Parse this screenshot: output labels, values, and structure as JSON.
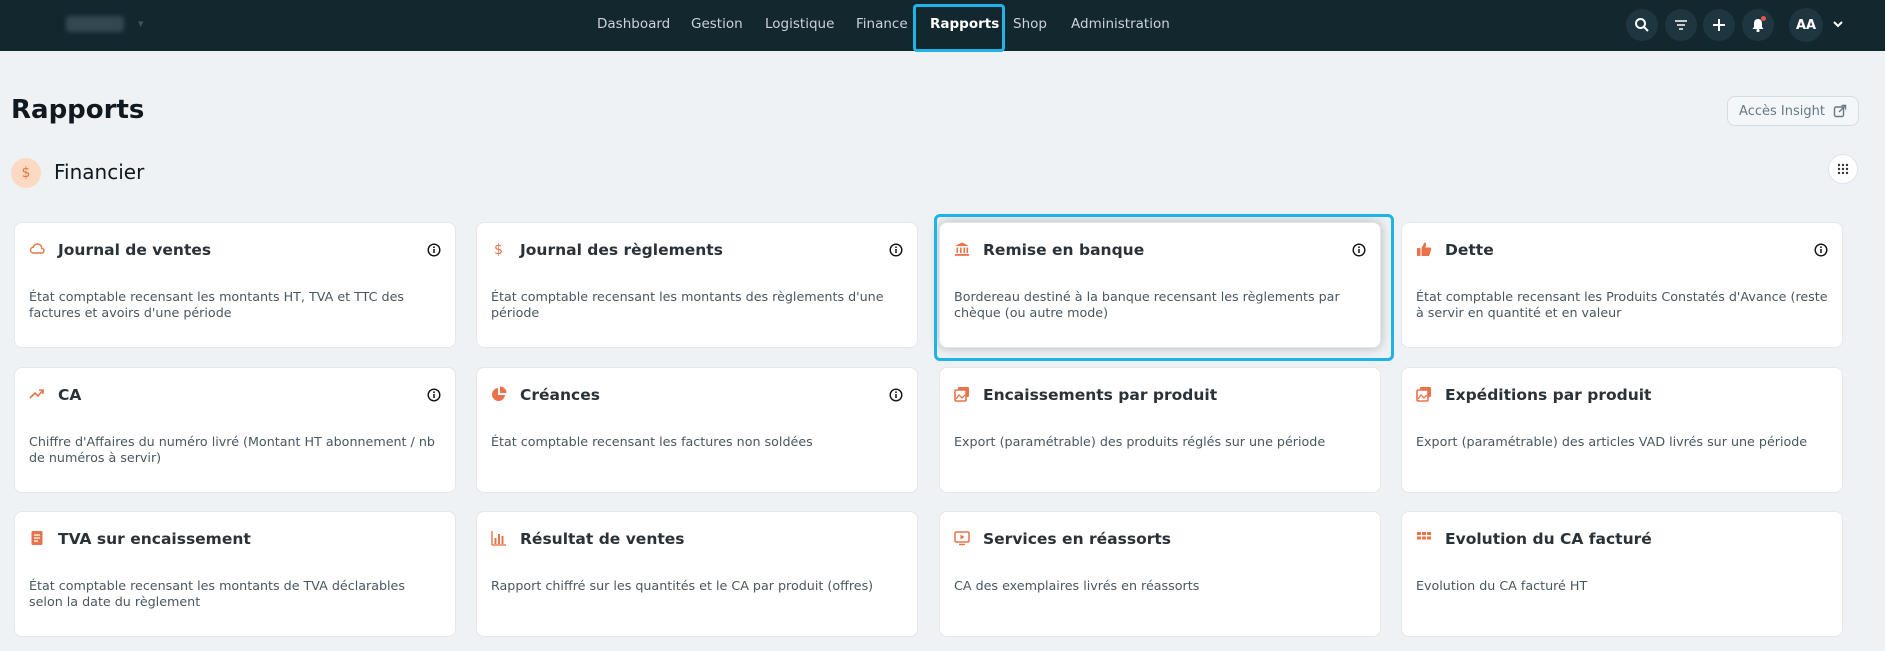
{
  "nav": {
    "items": [
      "Dashboard",
      "Gestion",
      "Logistique",
      "Finance",
      "Rapports",
      "Shop",
      "Administration"
    ],
    "active": "Rapports"
  },
  "user": {
    "initials": "AA"
  },
  "page": {
    "title": "Rapports",
    "insight_label": "Accès Insight"
  },
  "section": {
    "title": "Financier",
    "icon_glyph": "$"
  },
  "colors": {
    "accent": "#1fb3e8",
    "card_icon": "#e8734a",
    "topbar": "#13272f"
  },
  "cards": [
    {
      "icon": "cloud-icon",
      "title": "Journal de ventes",
      "desc": "État comptable recensant les montants HT, TVA et TTC des factures et avoirs d'une période",
      "info": true
    },
    {
      "icon": "dollar-icon",
      "title": "Journal des règlements",
      "desc": "État comptable recensant les montants des règlements d'une période",
      "info": true
    },
    {
      "icon": "bank-icon",
      "title": "Remise en banque",
      "desc": "Bordereau destiné à la banque recensant les règlements par chèque (ou autre mode)",
      "info": true
    },
    {
      "icon": "thumbs-up-icon",
      "title": "Dette",
      "desc": "État comptable recensant les Produits Constatés d'Avance (reste à servir en quantité et en valeur",
      "info": true
    },
    {
      "icon": "trend-up-icon",
      "title": "CA",
      "desc": "Chiffre d'Affaires du numéro livré (Montant HT abonnement / nb de numéros à servir)",
      "info": true
    },
    {
      "icon": "pie-chart-icon",
      "title": "Créances",
      "desc": "État comptable recensant les factures non soldées",
      "info": true
    },
    {
      "icon": "images-icon",
      "title": "Encaissements par produit",
      "desc": "Export (paramétrable) des produits réglés sur une période",
      "info": false
    },
    {
      "icon": "images-icon",
      "title": "Expéditions par produit",
      "desc": "Export (paramétrable) des articles VAD livrés sur une période",
      "info": false
    },
    {
      "icon": "document-icon",
      "title": "TVA sur encaissement",
      "desc": "État comptable recensant les montants de TVA déclarables selon la date du règlement",
      "info": false
    },
    {
      "icon": "bar-chart-icon",
      "title": "Résultat de ventes",
      "desc": "Rapport chiffré sur les quantités et le CA par produit (offres)",
      "info": false
    },
    {
      "icon": "monitor-icon",
      "title": "Services en réassorts",
      "desc": "CA des exemplaires livrés en réassorts",
      "info": false
    },
    {
      "icon": "grid-icon",
      "title": "Evolution du CA facturé",
      "desc": "Evolution du CA facturé HT",
      "info": false
    }
  ]
}
